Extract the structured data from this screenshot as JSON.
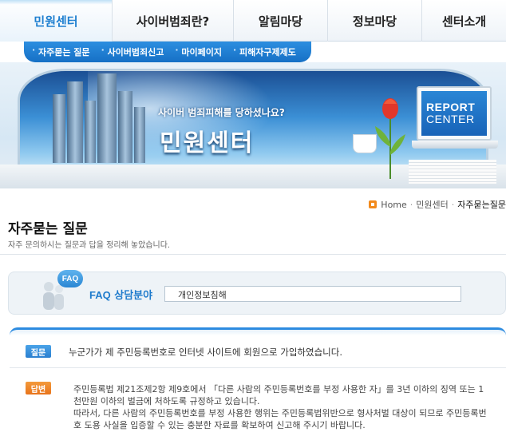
{
  "top_nav": {
    "tabs": [
      {
        "label": "민원센터",
        "active": true
      },
      {
        "label": "사이버범죄란?",
        "active": false
      },
      {
        "label": "알림마당",
        "active": false
      },
      {
        "label": "정보마당",
        "active": false
      },
      {
        "label": "센터소개",
        "active": false
      }
    ]
  },
  "sub_nav": {
    "items": [
      "자주묻는 질문",
      "사이버범죄신고",
      "마이페이지",
      "피해자구제제도"
    ]
  },
  "banner": {
    "tagline": "사이버 범죄피해를 당하셨나요?",
    "title": "민원센터",
    "monitor_line1": "REPORT",
    "monitor_line2": "CENTER"
  },
  "breadcrumb": {
    "home": "Home",
    "section": "민원센터",
    "current": "자주묻는질문"
  },
  "page": {
    "title": "자주묻는 질문",
    "description": "자주 문의하시는 질문과 답을 정리해 놓았습니다."
  },
  "faq_filter": {
    "badge": "FAQ",
    "label_en": "FAQ",
    "label_ko": "상담분야",
    "selected": "개인정보침해"
  },
  "qa": {
    "question_badge": "질문",
    "question": "누군가가 제 주민등록번호로 인터넷 사이트에 회원으로 가입하였습니다.",
    "answer_badge": "답변",
    "answer_paragraphs": [
      "주민등록법 제21조제2항 제9호에서 「다른 사람의 주민등록번호를 부정 사용한 자」를 3년 이하의 징역 또는 1천만원 이하의 벌금에 처하도록 규정하고 있습니다.",
      "따라서, 다른 사람의 주민등록번호를 부정 사용한 행위는 주민등록법위반으로 형사처벌 대상이 되므로 주민등록번호 도용 사실을 입증할 수 있는 충분한 자료를 확보하여 신고해 주시기 바랍니다."
    ]
  },
  "colors": {
    "accent_blue": "#1e7fd0",
    "answer_orange": "#e8731b",
    "breadcrumb_home": "#f28a1c"
  }
}
